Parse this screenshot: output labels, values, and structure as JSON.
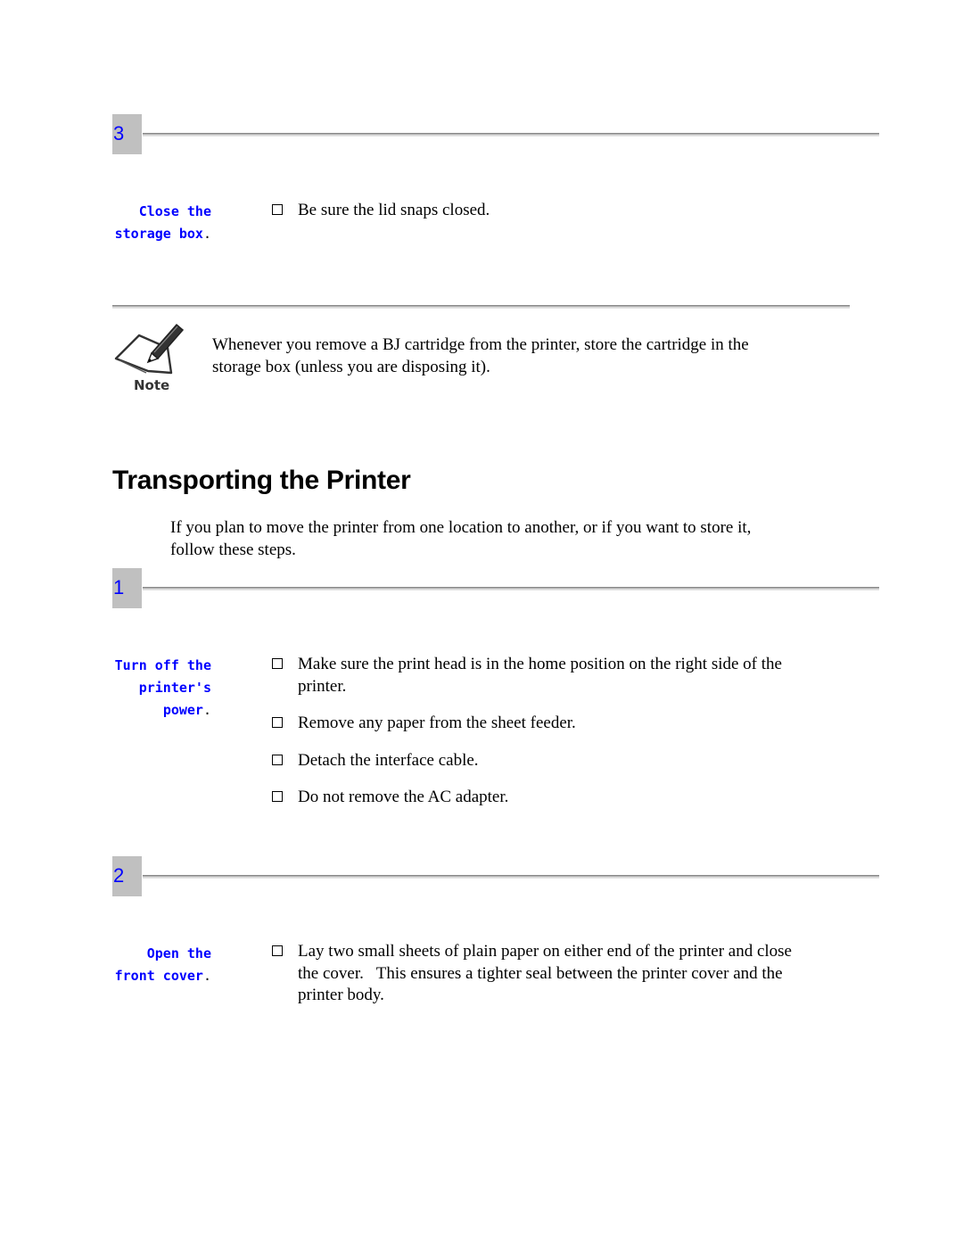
{
  "colors": {
    "step_box": "#c0c0c0",
    "step_number": "#0000ff",
    "side_label": "#0000ff",
    "rule_dark": "#8a8a8a",
    "rule_light": "#d4d4d4"
  },
  "top_step": {
    "number": "3",
    "label_line1": "Close the",
    "label_line2": "storage box",
    "label_end": ".",
    "bullets": [
      "Be sure the lid snaps closed."
    ]
  },
  "note": {
    "icon": "note-pencil-icon",
    "icon_caption": "Note",
    "text": "Whenever you remove a BJ cartridge from the printer, store the cartridge in the storage box (unless you are disposing it)."
  },
  "section": {
    "title": "Transporting the Printer",
    "intro": "If you plan to move the printer from one location to another, or if you want to store it, follow these steps."
  },
  "steps": [
    {
      "number": "1",
      "label_lines": [
        "Turn off the",
        "printer's",
        "power"
      ],
      "label_end": ".",
      "bullets": [
        "Make sure the print head is in the home position on the right side of the printer.",
        "Remove any paper from the sheet feeder.",
        "Detach the interface cable.",
        "Do not remove the AC adapter."
      ]
    },
    {
      "number": "2",
      "label_lines": [
        "Open the",
        "front cover"
      ],
      "label_end": ".",
      "bullets": [
        "Lay two small sheets of plain paper on either end of the printer and close the cover.   This ensures a tighter seal between the printer cover and the printer body."
      ]
    }
  ]
}
